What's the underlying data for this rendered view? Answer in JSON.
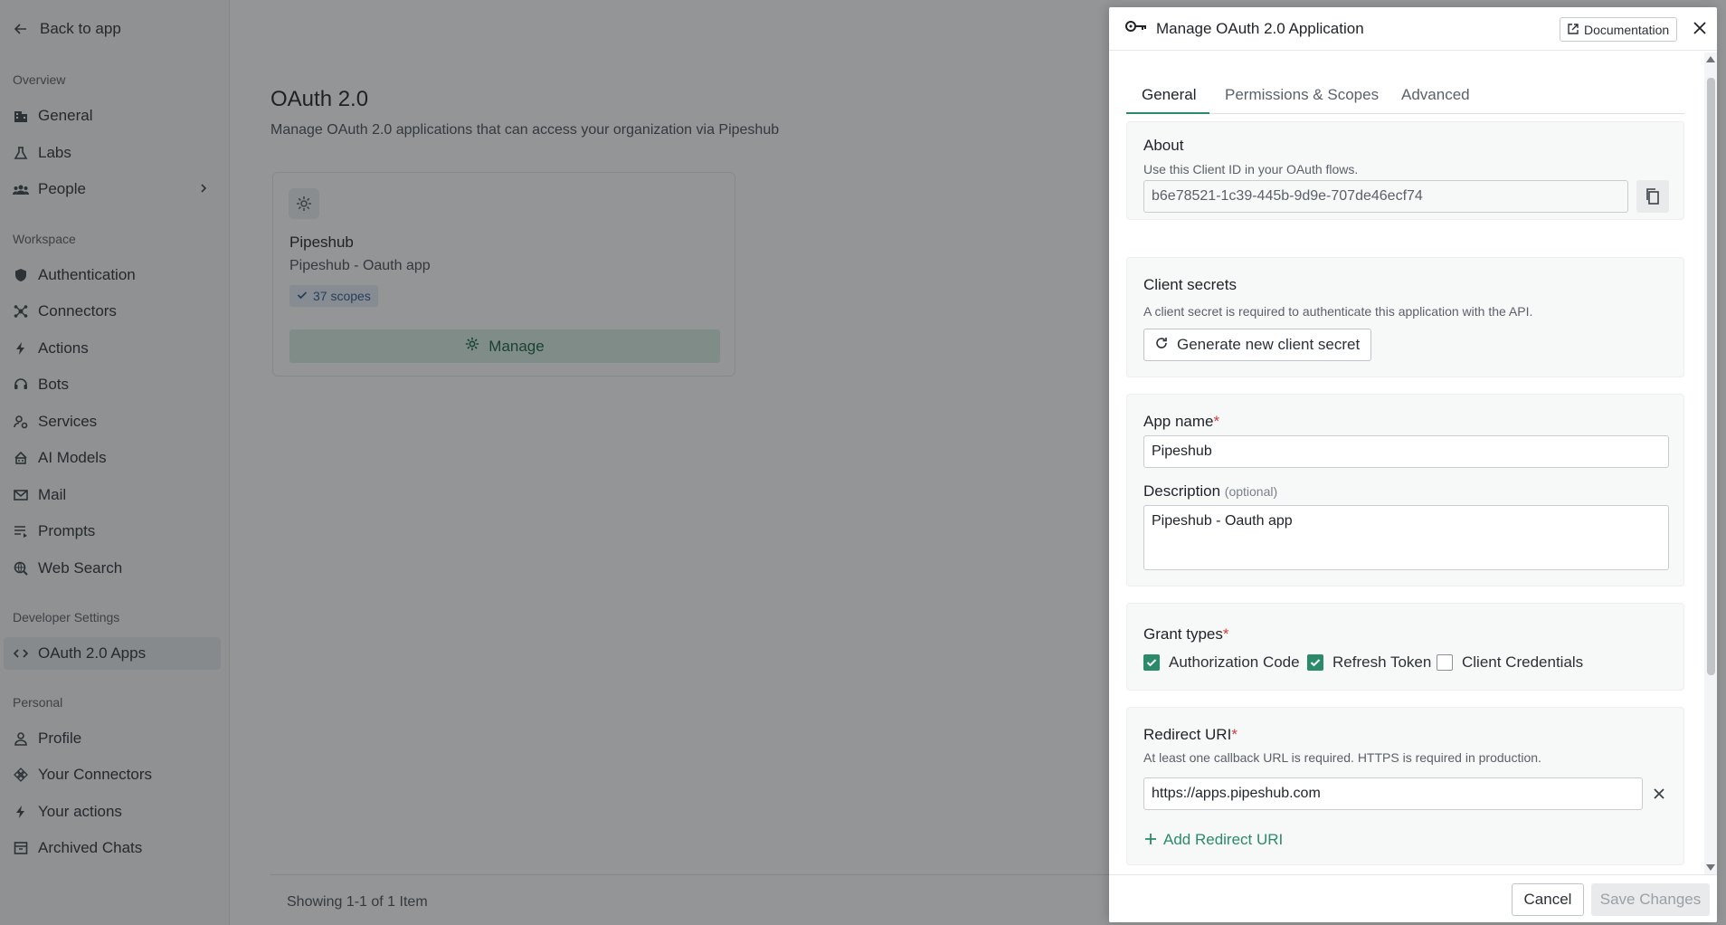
{
  "sidebar": {
    "back_label": "Back to app",
    "overview_title": "Overview",
    "overview_items": [
      {
        "label": "General",
        "icon": "building-icon"
      },
      {
        "label": "Labs",
        "icon": "flask-icon"
      },
      {
        "label": "People",
        "icon": "people-icon"
      }
    ],
    "workspace_title": "Workspace",
    "workspace_items": [
      {
        "label": "Authentication",
        "icon": "shield-icon"
      },
      {
        "label": "Connectors",
        "icon": "hub-icon"
      },
      {
        "label": "Actions",
        "icon": "bolt-icon"
      },
      {
        "label": "Bots",
        "icon": "headset-icon"
      },
      {
        "label": "Services",
        "icon": "services-icon"
      },
      {
        "label": "AI Models",
        "icon": "robot-icon"
      },
      {
        "label": "Mail",
        "icon": "mail-icon"
      },
      {
        "label": "Prompts",
        "icon": "prompts-icon"
      },
      {
        "label": "Web Search",
        "icon": "globe-search-icon"
      }
    ],
    "developer_title": "Developer Settings",
    "developer_items": [
      {
        "label": "OAuth 2.0 Apps",
        "icon": "code-icon",
        "active": true
      }
    ],
    "personal_title": "Personal",
    "personal_items": [
      {
        "label": "Profile",
        "icon": "user-icon"
      },
      {
        "label": "Your Connectors",
        "icon": "connectors-icon"
      },
      {
        "label": "Your actions",
        "icon": "bolt-icon"
      },
      {
        "label": "Archived Chats",
        "icon": "archive-icon"
      }
    ]
  },
  "main": {
    "title": "OAuth 2.0",
    "subtitle": "Manage OAuth 2.0 applications that can access your organization via Pipeshub",
    "card": {
      "name": "Pipeshub",
      "description": "Pipeshub - Oauth app",
      "scopes_label": "37 scopes",
      "manage_label": "Manage"
    },
    "footer_text": "Showing 1-1 of 1 Item"
  },
  "panel": {
    "title": "Manage OAuth 2.0 Application",
    "documentation_label": "Documentation",
    "tabs": [
      "General",
      "Permissions & Scopes",
      "Advanced"
    ],
    "active_tab": "General",
    "about": {
      "title": "About",
      "help": "Use this Client ID in your OAuth flows.",
      "client_id": "b6e78521-1c39-445b-9d9e-707de46ecf74"
    },
    "secrets": {
      "title": "Client secrets",
      "help": "A client secret is required to authenticate this application with the API.",
      "generate_label": "Generate new client secret"
    },
    "app_name": {
      "label": "App name",
      "required": "*",
      "value": "Pipeshub"
    },
    "description": {
      "label": "Description",
      "optional": "(optional)",
      "value": "Pipeshub - Oauth app"
    },
    "grant_types": {
      "label": "Grant types",
      "required": "*",
      "options": [
        {
          "label": "Authorization Code",
          "checked": true
        },
        {
          "label": "Refresh Token",
          "checked": true
        },
        {
          "label": "Client Credentials",
          "checked": false
        }
      ]
    },
    "redirect": {
      "label": "Redirect URI",
      "required": "*",
      "help": "At least one callback URL is required. HTTPS is required in production.",
      "uri": "https://apps.pipeshub.com",
      "add_label": "Add Redirect URI"
    },
    "cancel_label": "Cancel",
    "save_label": "Save Changes"
  },
  "colors": {
    "accent": "#2a8a6a",
    "required": "#d13b3b",
    "badge_bg": "#e6eef8",
    "badge_text": "#2c5b8f"
  }
}
